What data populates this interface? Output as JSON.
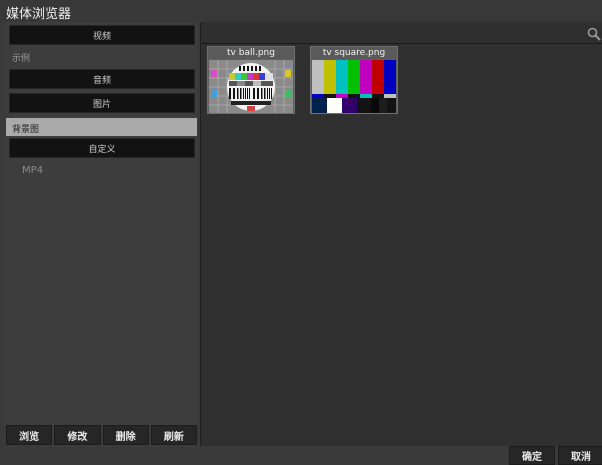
{
  "window": {
    "title": "媒体浏览器"
  },
  "sidebar": {
    "sections": [
      {
        "label": "视频",
        "type": "header"
      },
      {
        "label": "示例",
        "type": "item"
      },
      {
        "label": "音频",
        "type": "header"
      },
      {
        "label": "图片",
        "type": "header"
      },
      {
        "label": "背景图",
        "type": "item",
        "selected": true
      },
      {
        "label": "自定义",
        "type": "header"
      },
      {
        "label": "MP4",
        "type": "item"
      }
    ],
    "buttons": {
      "browse": "浏览",
      "modify": "修改",
      "delete": "删除",
      "refresh": "刷新"
    }
  },
  "search": {
    "value": "",
    "icon": "search-icon"
  },
  "media": [
    {
      "name": "tv ball.png",
      "thumbnail": "test-card-ball"
    },
    {
      "name": "tv square.png",
      "thumbnail": "color-bars"
    }
  ],
  "footer": {
    "ok_label": "确定",
    "cancel_label": "取消"
  }
}
